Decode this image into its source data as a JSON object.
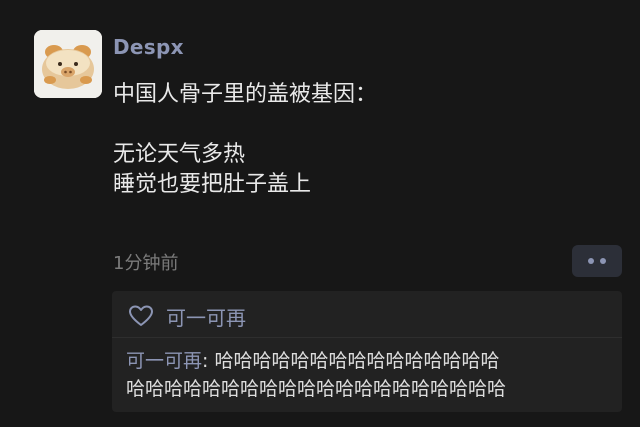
{
  "post": {
    "author": "Despx",
    "text_line_1": "中国人骨子里的盖被基因：",
    "text_line_2": "无论天气多热",
    "text_line_3": "睡觉也要把肚子盖上",
    "timestamp": "1分钟前"
  },
  "likes": {
    "icon": "heart-outline-icon",
    "names": "可一可再"
  },
  "comments": [
    {
      "author": "可一可再",
      "separator": ": ",
      "text_line_1": "哈哈哈哈哈哈哈哈哈哈哈哈哈哈哈",
      "text_line_2": "哈哈哈哈哈哈哈哈哈哈哈哈哈哈哈哈哈哈哈哈"
    }
  ],
  "colors": {
    "background": "#171717",
    "accent": "#8c95b4",
    "panel": "#222222",
    "text": "#e9e9e9",
    "muted": "#7b7b7b"
  }
}
